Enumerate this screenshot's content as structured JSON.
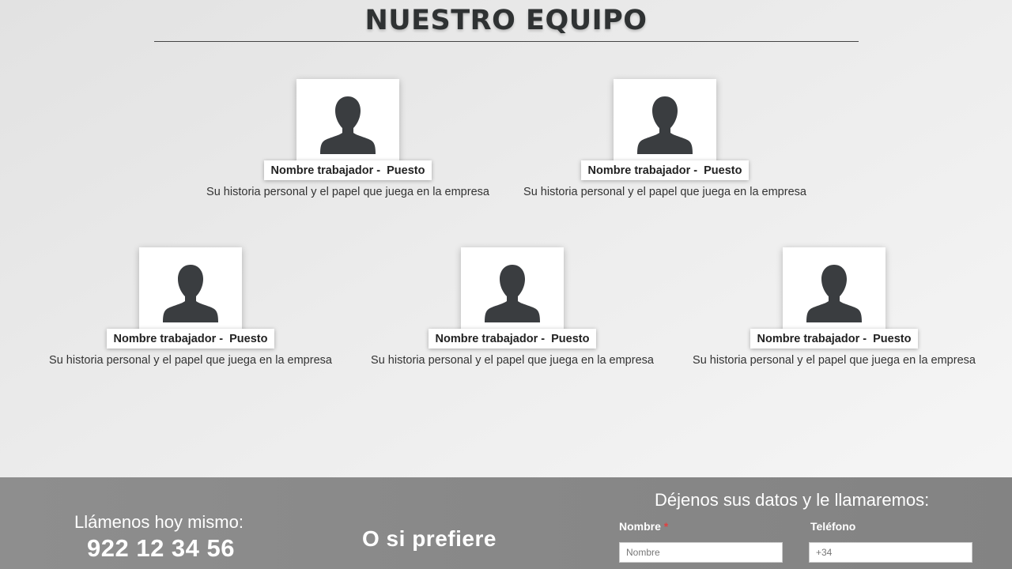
{
  "team": {
    "title": "NUESTRO EQUIPO",
    "members": [
      {
        "name": "Nombre trabajador -  Puesto",
        "bio": "Su historia personal y el papel que juega en la empresa",
        "icon": "person-silhouette-icon"
      },
      {
        "name": "Nombre trabajador -  Puesto",
        "bio": "Su historia personal y el papel que juega en la empresa",
        "icon": "person-silhouette-icon"
      },
      {
        "name": "Nombre trabajador -  Puesto",
        "bio": "Su historia personal y el papel que juega en la empresa",
        "icon": "person-silhouette-icon"
      },
      {
        "name": "Nombre trabajador -  Puesto",
        "bio": "Su historia personal y el papel que juega en la empresa",
        "icon": "person-silhouette-icon"
      },
      {
        "name": "Nombre trabajador -  Puesto",
        "bio": "Su historia personal y el papel que juega en la empresa",
        "icon": "person-silhouette-icon"
      }
    ]
  },
  "footer": {
    "call_label": "Llámenos hoy mismo:",
    "phone": "922 12 34 56",
    "prefer": "O si prefiere",
    "form": {
      "title": "Déjenos sus datos y le llamaremos:",
      "name_label": "Nombre",
      "required_mark": "*",
      "name_placeholder": "Nombre",
      "phone_label": "Teléfono",
      "phone_placeholder": "+34"
    }
  },
  "colors": {
    "footer_bg": "#888888",
    "silhouette": "#3a3d40",
    "required": "#e04040"
  }
}
